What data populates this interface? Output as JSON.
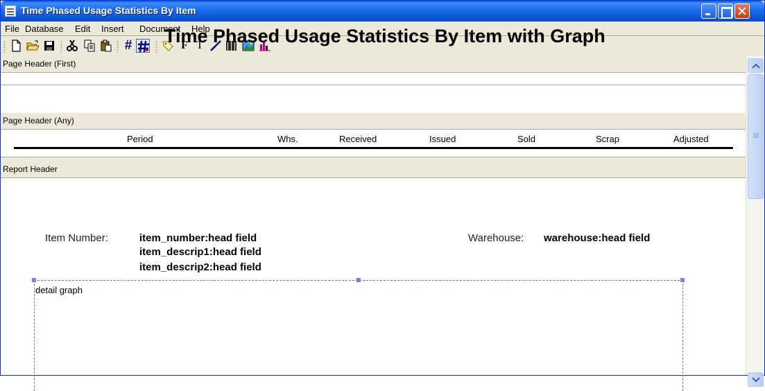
{
  "window": {
    "title": "Time Phased Usage Statistics By Item"
  },
  "menu": [
    "File",
    "Database",
    "Edit",
    "Insert",
    "Document",
    "Help"
  ],
  "toolbar": {
    "icons": [
      "new-document-icon",
      "open-folder-icon",
      "save-icon",
      "cut-icon",
      "copy-icon",
      "paste-icon",
      "grid-icon",
      "snap-to-grid-icon",
      "label-tag-icon",
      "field-icon",
      "text-icon",
      "line-icon",
      "barcode-icon",
      "image-icon",
      "graph-icon"
    ],
    "pressed": "snap-to-grid-icon",
    "field_glyph": "F",
    "text_glyph": "T",
    "grid_glyph": "#"
  },
  "bands": {
    "page_header_first": "Page Header (First)",
    "page_header_any": "Page Header (Any)",
    "report_header": "Report Header"
  },
  "columns": [
    "Period",
    "Whs.",
    "Received",
    "Issued",
    "Sold",
    "Scrap",
    "Adjusted"
  ],
  "report": {
    "title": "Time Phased Usage Statistics By Item with Graph",
    "item_number_label": "Item Number:",
    "item_number_field": "item_number:head field",
    "descrip1_field": "item_descrip1:head field",
    "descrip2_field": "item_descrip2:head field",
    "warehouse_label": "Warehouse:",
    "warehouse_field": "warehouse:head field",
    "graph_label": "detail graph"
  },
  "colors": {
    "titlebar": "#0b57d6",
    "chrome": "#ece9d8",
    "selection_handle": "#7b7bef"
  }
}
